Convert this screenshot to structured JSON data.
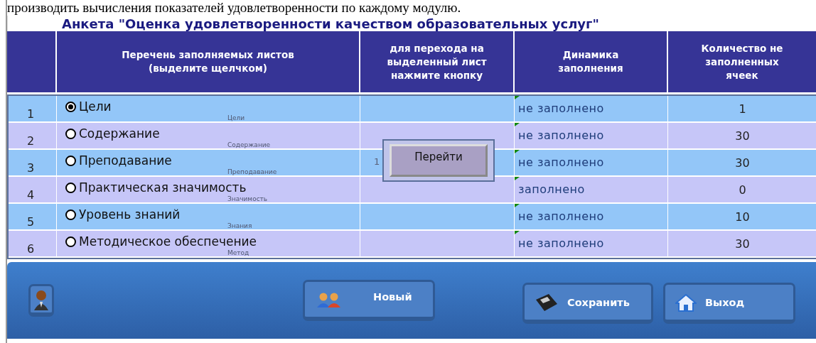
{
  "document_text": "производить вычисления показателей удовлетворенности по каждому модулю.",
  "form_title": "Анкета \"Оценка удовлетворенности качеством образовательных услуг\"",
  "table": {
    "columns": [
      "Перечень заполняемых листов (выделите щелчком)",
      "для перехода на выделенный лист нажмите кнопку",
      "Динамика заполнения",
      "Количество не заполненных ячеек"
    ],
    "rows": [
      {
        "number": "1",
        "sheet": "Цели",
        "hint": "Цели",
        "selected": true,
        "status": "не заполнено",
        "empty_cells": "1"
      },
      {
        "number": "2",
        "sheet": "Содержание",
        "hint": "Содержание",
        "selected": false,
        "status": "не заполнено",
        "empty_cells": "30"
      },
      {
        "number": "3",
        "sheet": "Преподавание",
        "hint": "Преподавание",
        "selected": false,
        "status": "не заполнено",
        "empty_cells": "30"
      },
      {
        "number": "4",
        "sheet": "Практическая значимость",
        "hint": "Значимость",
        "selected": false,
        "status": "заполнено",
        "empty_cells": "0"
      },
      {
        "number": "5",
        "sheet": "Уровень знаний",
        "hint": "Знания",
        "selected": false,
        "status": "не заполнено",
        "empty_cells": "10"
      },
      {
        "number": "6",
        "sheet": "Методическое обеспечение",
        "hint": "Метод",
        "selected": false,
        "status": "не заполнено",
        "empty_cells": "30"
      }
    ],
    "go_button": "Перейти",
    "go_hint": "1"
  },
  "toolbar": [
    {
      "kind": "avatar"
    },
    {
      "kind": "new",
      "label": "Новый"
    },
    {
      "kind": "save",
      "label": "Сохранить"
    },
    {
      "kind": "exit",
      "label": "Выход"
    }
  ]
}
